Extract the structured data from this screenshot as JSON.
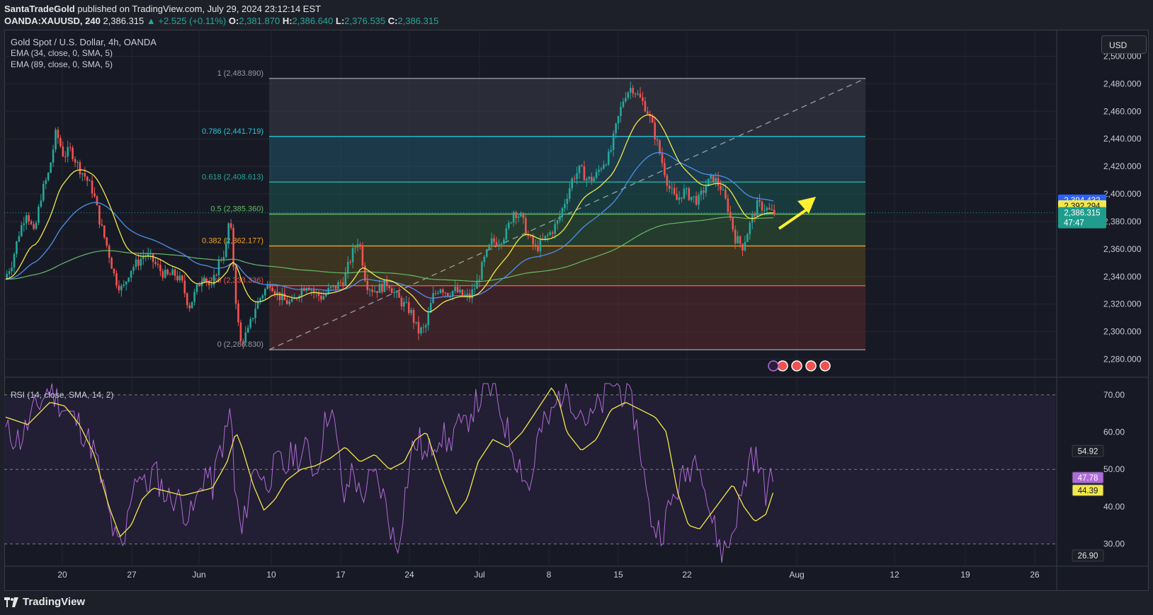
{
  "header": {
    "publisher": "SantaTradeGold",
    "published_text": "published on TradingView.com, July 29, 2024 23:12:14 EST",
    "symbol": "OANDA:XAUUSD, 240",
    "last": "2,386.315",
    "change": "▲ +2.525 (+0.11%)",
    "o_label": "O:",
    "o": "2,381.870",
    "h_label": "H:",
    "h": "2,386.640",
    "l_label": "L:",
    "l": "2,376.535",
    "c_label": "C:",
    "c": "2,386.315"
  },
  "legend": {
    "title": "Gold Spot / U.S. Dollar, 4h, OANDA",
    "ema1": "EMA (34, close, 0, SMA, 5)",
    "ema2": "EMA (89, close, 0, SMA, 5)",
    "rsi": "RSI (14, close, SMA, 14, 2)"
  },
  "currency_button": "USD",
  "footer_brand": "TradingView",
  "colors": {
    "up": "#26a69a",
    "down": "#ef5350",
    "ema34": "#f2e84b",
    "ema89": "#4f8fe8",
    "long_ema": "#66bb6a",
    "rsi": "#b06bd8",
    "rsi_ma": "#f2e84b",
    "arrow": "#fff030"
  },
  "chart_data": {
    "type": "candlestick",
    "price_axis": {
      "ticks": [
        "2,500.000",
        "2,480.000",
        "2,460.000",
        "2,440.000",
        "2,420.000",
        "2,400.000",
        "2,380.000",
        "2,360.000",
        "2,340.000",
        "2,320.000",
        "2,300.000",
        "2,280.000"
      ],
      "tick_values": [
        2500,
        2480,
        2460,
        2440,
        2420,
        2400,
        2380,
        2360,
        2340,
        2320,
        2300,
        2280
      ],
      "range": [
        2271,
        2510
      ]
    },
    "time_axis": {
      "labels": [
        "20",
        "27",
        "Jun",
        "10",
        "17",
        "24",
        "Jul",
        "8",
        "15",
        "22",
        "Aug",
        "12",
        "19",
        "26"
      ]
    },
    "price_tags": [
      {
        "text": "2,394.432",
        "value": 2394.432,
        "bg": "#2962ff",
        "fg": "#ffffff"
      },
      {
        "text": "2,392.294",
        "value": 2392.294,
        "bg": "#f2e84b",
        "fg": "#131722"
      },
      {
        "text": "2,386.315",
        "sub": "47:47",
        "value": 2386.315,
        "bg": "#1f9c8c",
        "fg": "#ffffff"
      }
    ],
    "fibonacci": [
      {
        "level": "1",
        "label": "1 (2,483.890)",
        "value": 2483.89,
        "color": "#9598a1"
      },
      {
        "level": "0.786",
        "label": "0.786 (2,441.719)",
        "value": 2441.719,
        "color": "#26c6da"
      },
      {
        "level": "0.618",
        "label": "0.618 (2,408.613)",
        "value": 2408.613,
        "color": "#26a69a"
      },
      {
        "level": "0.5",
        "label": "0.5 (2,385.360)",
        "value": 2385.36,
        "color": "#66bb6a"
      },
      {
        "level": "0.382",
        "label": "0.382 (2,362.177)",
        "value": 2362.177,
        "color": "#f7a21b"
      },
      {
        "level": "0.236",
        "label": "0.236 (2,333.336)",
        "value": 2333.336,
        "color": "#ef5350"
      },
      {
        "level": "0",
        "label": "0 (2,286.830)",
        "value": 2286.83,
        "color": "#9598a1"
      }
    ],
    "price_path": [
      [
        0,
        2338
      ],
      [
        10,
        2350
      ],
      [
        20,
        2372
      ],
      [
        30,
        2388
      ],
      [
        40,
        2370
      ],
      [
        50,
        2400
      ],
      [
        60,
        2415
      ],
      [
        70,
        2445
      ],
      [
        80,
        2428
      ],
      [
        90,
        2432
      ],
      [
        100,
        2420
      ],
      [
        110,
        2412
      ],
      [
        120,
        2402
      ],
      [
        130,
        2378
      ],
      [
        140,
        2360
      ],
      [
        150,
        2338
      ],
      [
        160,
        2330
      ],
      [
        170,
        2345
      ],
      [
        180,
        2350
      ],
      [
        190,
        2356
      ],
      [
        200,
        2352
      ],
      [
        210,
        2345
      ],
      [
        220,
        2340
      ],
      [
        230,
        2342
      ],
      [
        240,
        2336
      ],
      [
        250,
        2318
      ],
      [
        260,
        2330
      ],
      [
        270,
        2343
      ],
      [
        280,
        2330
      ],
      [
        290,
        2350
      ],
      [
        300,
        2360
      ],
      [
        305,
        2385
      ],
      [
        310,
        2350
      ],
      [
        315,
        2312
      ],
      [
        320,
        2292
      ],
      [
        330,
        2300
      ],
      [
        340,
        2318
      ],
      [
        350,
        2328
      ],
      [
        360,
        2336
      ],
      [
        370,
        2327
      ],
      [
        380,
        2322
      ],
      [
        390,
        2320
      ],
      [
        400,
        2330
      ],
      [
        410,
        2335
      ],
      [
        420,
        2328
      ],
      [
        430,
        2325
      ],
      [
        440,
        2330
      ],
      [
        450,
        2333
      ],
      [
        460,
        2338
      ],
      [
        470,
        2355
      ],
      [
        480,
        2368
      ],
      [
        490,
        2335
      ],
      [
        500,
        2330
      ],
      [
        510,
        2332
      ],
      [
        520,
        2336
      ],
      [
        530,
        2326
      ],
      [
        540,
        2320
      ],
      [
        550,
        2315
      ],
      [
        560,
        2300
      ],
      [
        570,
        2302
      ],
      [
        580,
        2325
      ],
      [
        590,
        2333
      ],
      [
        600,
        2328
      ],
      [
        610,
        2330
      ],
      [
        620,
        2326
      ],
      [
        630,
        2325
      ],
      [
        640,
        2335
      ],
      [
        650,
        2352
      ],
      [
        660,
        2365
      ],
      [
        670,
        2366
      ],
      [
        680,
        2372
      ],
      [
        690,
        2388
      ],
      [
        700,
        2383
      ],
      [
        710,
        2368
      ],
      [
        720,
        2360
      ],
      [
        730,
        2366
      ],
      [
        740,
        2372
      ],
      [
        750,
        2380
      ],
      [
        760,
        2396
      ],
      [
        770,
        2412
      ],
      [
        780,
        2418
      ],
      [
        790,
        2410
      ],
      [
        800,
        2412
      ],
      [
        810,
        2422
      ],
      [
        820,
        2428
      ],
      [
        830,
        2452
      ],
      [
        840,
        2472
      ],
      [
        850,
        2478
      ],
      [
        860,
        2470
      ],
      [
        870,
        2462
      ],
      [
        880,
        2445
      ],
      [
        890,
        2425
      ],
      [
        900,
        2405
      ],
      [
        910,
        2395
      ],
      [
        920,
        2402
      ],
      [
        930,
        2398
      ],
      [
        940,
        2395
      ],
      [
        950,
        2406
      ],
      [
        960,
        2412
      ],
      [
        970,
        2405
      ],
      [
        980,
        2390
      ],
      [
        990,
        2368
      ],
      [
        1000,
        2362
      ],
      [
        1010,
        2378
      ],
      [
        1020,
        2392
      ],
      [
        1030,
        2390
      ],
      [
        1040,
        2386
      ]
    ],
    "rsi_axis": {
      "ticks": [
        "70.00",
        "60.00",
        "50.00",
        "40.00",
        "30.00"
      ],
      "tick_values": [
        70,
        60,
        50,
        40,
        30
      ],
      "range": [
        25,
        73
      ]
    },
    "rsi_tags": [
      {
        "text": "54.92",
        "value": 54.92,
        "bg": "#1e2029",
        "fg": "#e6e6e6"
      },
      {
        "text": "47.78",
        "value": 47.78,
        "bg": "#b06bd8",
        "fg": "#ffffff"
      },
      {
        "text": "44.39",
        "value": 44.39,
        "bg": "#f2e84b",
        "fg": "#131722"
      },
      {
        "text": "26.90",
        "value": 26.9,
        "bg": "#1e2029",
        "fg": "#e6e6e6"
      }
    ],
    "rsi_path": [
      [
        0,
        60
      ],
      [
        20,
        58
      ],
      [
        40,
        66
      ],
      [
        60,
        72
      ],
      [
        80,
        66
      ],
      [
        100,
        62
      ],
      [
        120,
        55
      ],
      [
        140,
        38
      ],
      [
        150,
        30
      ],
      [
        160,
        28
      ],
      [
        170,
        45
      ],
      [
        180,
        50
      ],
      [
        190,
        44
      ],
      [
        200,
        50
      ],
      [
        210,
        46
      ],
      [
        220,
        42
      ],
      [
        230,
        43
      ],
      [
        240,
        40
      ],
      [
        250,
        37
      ],
      [
        260,
        42
      ],
      [
        270,
        50
      ],
      [
        280,
        45
      ],
      [
        290,
        55
      ],
      [
        300,
        60
      ],
      [
        305,
        68
      ],
      [
        310,
        45
      ],
      [
        320,
        32
      ],
      [
        330,
        45
      ],
      [
        340,
        52
      ],
      [
        350,
        46
      ],
      [
        360,
        49
      ],
      [
        370,
        52
      ],
      [
        380,
        50
      ],
      [
        390,
        55
      ],
      [
        400,
        53
      ],
      [
        410,
        56
      ],
      [
        420,
        48
      ],
      [
        430,
        60
      ],
      [
        440,
        68
      ],
      [
        450,
        55
      ],
      [
        460,
        40
      ],
      [
        470,
        52
      ],
      [
        480,
        42
      ],
      [
        490,
        46
      ],
      [
        500,
        48
      ],
      [
        510,
        44
      ],
      [
        520,
        36
      ],
      [
        530,
        28
      ],
      [
        540,
        42
      ],
      [
        550,
        55
      ],
      [
        560,
        58
      ],
      [
        570,
        52
      ],
      [
        580,
        58
      ],
      [
        590,
        60
      ],
      [
        600,
        56
      ],
      [
        610,
        62
      ],
      [
        620,
        60
      ],
      [
        630,
        66
      ],
      [
        640,
        68
      ],
      [
        650,
        72
      ],
      [
        660,
        71
      ],
      [
        670,
        66
      ],
      [
        680,
        60
      ],
      [
        690,
        54
      ],
      [
        700,
        50
      ],
      [
        710,
        44
      ],
      [
        720,
        58
      ],
      [
        730,
        62
      ],
      [
        740,
        64
      ],
      [
        750,
        70
      ],
      [
        760,
        72
      ],
      [
        770,
        68
      ],
      [
        780,
        66
      ],
      [
        790,
        62
      ],
      [
        800,
        66
      ],
      [
        810,
        68
      ],
      [
        820,
        74
      ],
      [
        830,
        72
      ],
      [
        840,
        70
      ],
      [
        850,
        66
      ],
      [
        860,
        56
      ],
      [
        870,
        40
      ],
      [
        880,
        34
      ],
      [
        890,
        34
      ],
      [
        900,
        40
      ],
      [
        910,
        45
      ],
      [
        920,
        48
      ],
      [
        930,
        52
      ],
      [
        940,
        55
      ],
      [
        950,
        42
      ],
      [
        960,
        34
      ],
      [
        970,
        28
      ],
      [
        980,
        30
      ],
      [
        990,
        38
      ],
      [
        1000,
        45
      ],
      [
        1010,
        55
      ],
      [
        1020,
        51
      ],
      [
        1030,
        44
      ],
      [
        1040,
        48
      ]
    ],
    "rsi_ma_path": [
      [
        0,
        64
      ],
      [
        30,
        62
      ],
      [
        60,
        68
      ],
      [
        80,
        67
      ],
      [
        100,
        62
      ],
      [
        120,
        54
      ],
      [
        140,
        40
      ],
      [
        155,
        32
      ],
      [
        170,
        35
      ],
      [
        185,
        42
      ],
      [
        200,
        45
      ],
      [
        220,
        44
      ],
      [
        240,
        43
      ],
      [
        260,
        44
      ],
      [
        280,
        45
      ],
      [
        300,
        52
      ],
      [
        312,
        60
      ],
      [
        320,
        56
      ],
      [
        335,
        46
      ],
      [
        350,
        39
      ],
      [
        365,
        42
      ],
      [
        380,
        47
      ],
      [
        400,
        50
      ],
      [
        420,
        51
      ],
      [
        440,
        53
      ],
      [
        460,
        56
      ],
      [
        480,
        52
      ],
      [
        500,
        54
      ],
      [
        520,
        50
      ],
      [
        540,
        52
      ],
      [
        555,
        58
      ],
      [
        570,
        60
      ],
      [
        590,
        48
      ],
      [
        610,
        38
      ],
      [
        625,
        42
      ],
      [
        640,
        52
      ],
      [
        660,
        58
      ],
      [
        680,
        56
      ],
      [
        700,
        60
      ],
      [
        720,
        66
      ],
      [
        740,
        72
      ],
      [
        750,
        68
      ],
      [
        760,
        60
      ],
      [
        780,
        55
      ],
      [
        800,
        58
      ],
      [
        820,
        66
      ],
      [
        840,
        68
      ],
      [
        860,
        66
      ],
      [
        880,
        64
      ],
      [
        895,
        60
      ],
      [
        910,
        44
      ],
      [
        925,
        35
      ],
      [
        940,
        34
      ],
      [
        955,
        38
      ],
      [
        970,
        42
      ],
      [
        985,
        46
      ],
      [
        1000,
        40
      ],
      [
        1015,
        36
      ],
      [
        1030,
        38
      ],
      [
        1040,
        44
      ]
    ],
    "annotation": "yellow arrow pointing up toward the 0.618 level"
  }
}
